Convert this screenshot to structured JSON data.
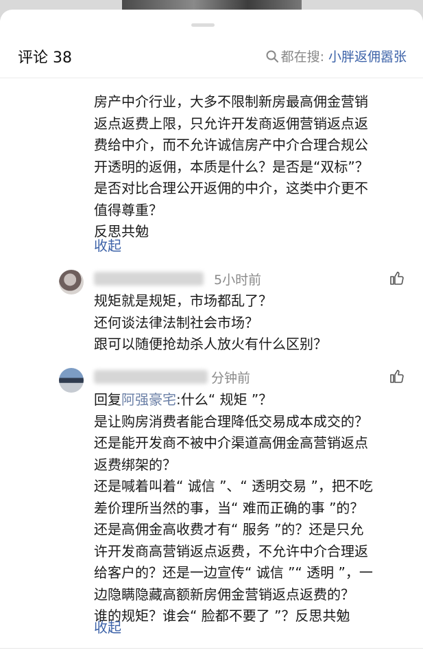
{
  "header": {
    "title": "评论 38",
    "search_prefix": "都在搜:",
    "search_term": "小胖返佣嚣张"
  },
  "comment_top": {
    "text": "房产中介行业，大多不限制新房最高佣金营销\n返点返费上限，只允许开发商返佣营销返点返\n费给中介，而不允许诚信房产中介合理合规公\n开透明的返佣，本质是什么？是否是“双标”？\n是否对比合理公开返佣的中介，这类中介更不\n值得尊重？\n反思共勉",
    "collapse_label": "收起"
  },
  "comment_a": {
    "time": "5小时前",
    "text": "规矩就是规矩，市场都乱了？\n还何谈法律法制社会市场？\n跟可以随便抢劫杀人放火有什么区别？"
  },
  "comment_b": {
    "time": "分钟前",
    "reply_prefix": "回复",
    "reply_to": "阿强豪宅",
    "reply_text": ":什么“ 规矩 ”？",
    "text": "是让购房消费者能合理降低交易成本成交的？\n还是能开发商不被中介渠道高佣金高营销返点\n返费绑架的？\n还是喊着叫着“ 诚信 ”、“ 透明交易 ”，把不吃\n差价理所当然的事，当“ 难而正确的事 ”的？\n还是高佣金高收费才有“ 服务 ”的？还是只允\n许开发商高营销返点返费，不允许中介合理返\n给客户的？还是一边宣传“ 诚信 ”“ 透明 ”，一\n边隐瞒隐藏高额新房佣金营销返点返费的？\n谁的规矩？谁会“ 脸都不要了 ”？反思共勉",
    "collapse_label": "收起"
  },
  "icons": {
    "search": "search-icon",
    "like": "thumbs-up-icon"
  },
  "colors": {
    "link": "#3c62a8",
    "muted": "#888888",
    "reply_name": "#6a7fa6"
  }
}
